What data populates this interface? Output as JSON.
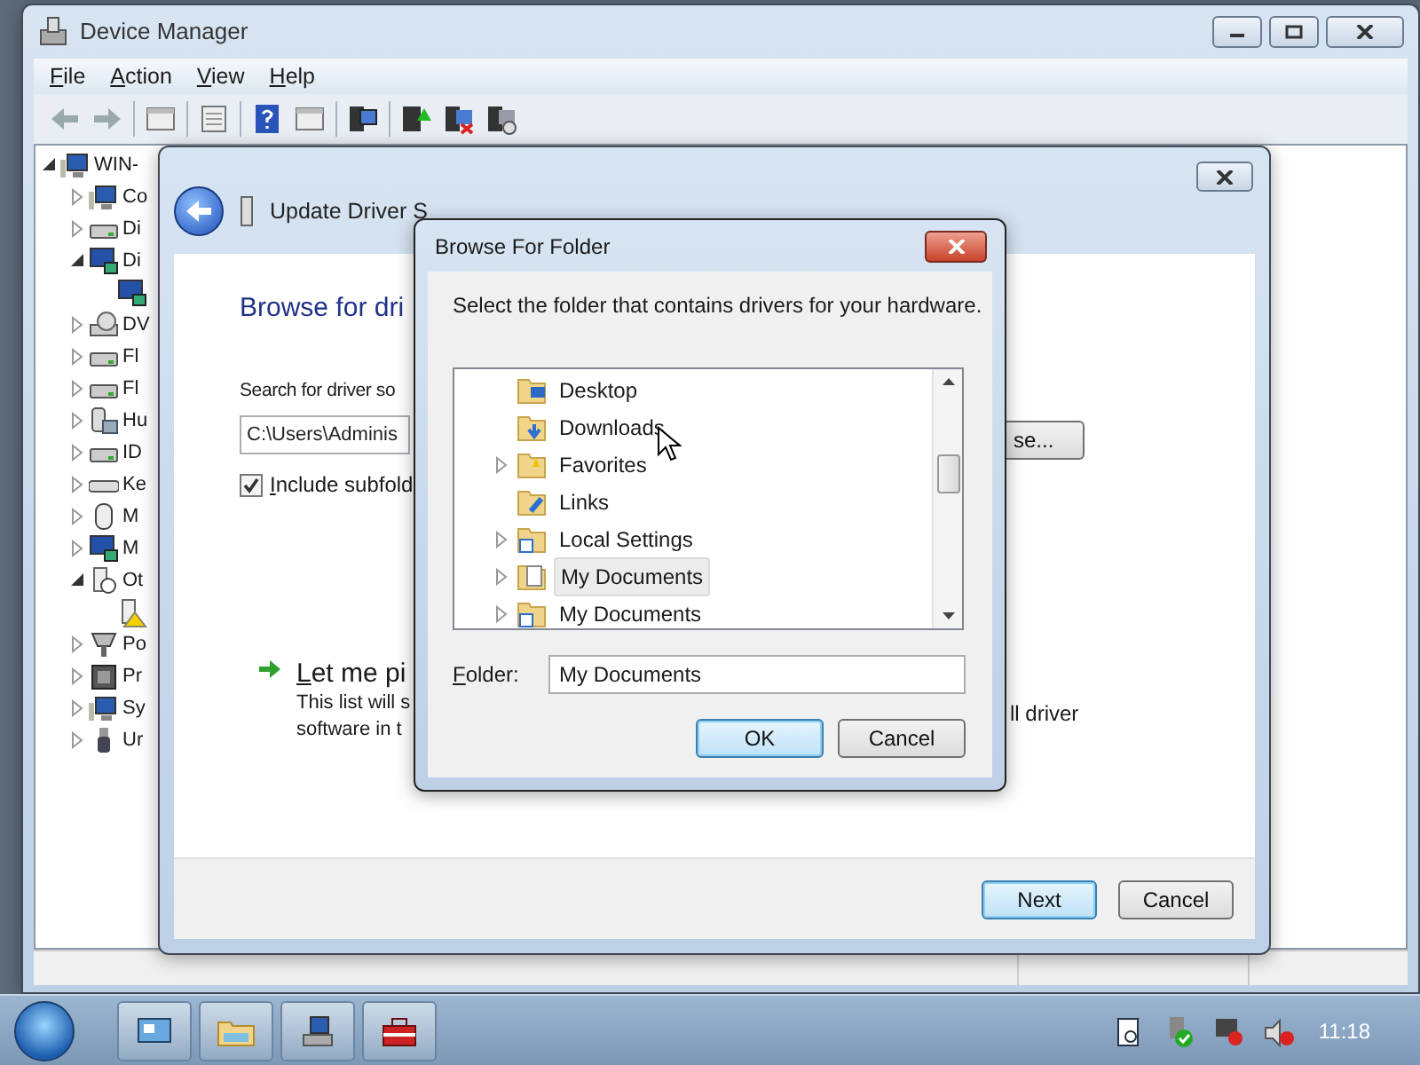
{
  "device_manager": {
    "title": "Device Manager",
    "menu": [
      "File",
      "Action",
      "View",
      "Help"
    ],
    "tree": {
      "label": "WIN-",
      "kind": "computer",
      "expanded": true,
      "children": [
        {
          "label": "Co",
          "kind": "computer",
          "expanded": false
        },
        {
          "label": "Di",
          "kind": "drive",
          "expanded": false
        },
        {
          "label": "Di",
          "kind": "display",
          "expanded": true,
          "children": [
            {
              "kind": "display"
            }
          ]
        },
        {
          "label": "DV",
          "kind": "dvd",
          "expanded": false
        },
        {
          "label": "Fl",
          "kind": "drive",
          "expanded": false
        },
        {
          "label": "Fl",
          "kind": "drive",
          "expanded": false
        },
        {
          "label": "Hu",
          "kind": "hid",
          "expanded": false
        },
        {
          "label": "ID",
          "kind": "drive",
          "expanded": false
        },
        {
          "label": "Ke",
          "kind": "keyboard",
          "expanded": false
        },
        {
          "label": "M",
          "kind": "mouse",
          "expanded": false
        },
        {
          "label": "M",
          "kind": "display",
          "expanded": false
        },
        {
          "label": "Ot",
          "kind": "unknown",
          "expanded": true,
          "children": [
            {
              "kind": "warning"
            }
          ]
        },
        {
          "label": "Po",
          "kind": "port",
          "expanded": false
        },
        {
          "label": "Pr",
          "kind": "chip",
          "expanded": false
        },
        {
          "label": "Sy",
          "kind": "computer",
          "expanded": false
        },
        {
          "label": "Ur",
          "kind": "usb",
          "expanded": false
        }
      ]
    }
  },
  "update_dialog": {
    "title": "Update Driver S",
    "heading": "Browse for dri",
    "search_label": "Search for driver so",
    "path_value": "C:\\Users\\Adminis",
    "browse_button": "se...",
    "include_subfolders": {
      "label": "Include subfold",
      "checked": true
    },
    "pick_option": {
      "title": "Let me pi",
      "line_1": "This list will s",
      "line_1_end": "ll driver",
      "line_2": "software in t"
    },
    "buttons": [
      "Next",
      "Cancel"
    ]
  },
  "browse_dialog": {
    "title": "Browse For Folder",
    "instruction": "Select the folder that contains drivers for your hardware.",
    "folders": [
      {
        "label": "Desktop",
        "kind": "desktop",
        "selected": false
      },
      {
        "label": "Downloads",
        "kind": "downloads",
        "selected": false
      },
      {
        "label": "Favorites",
        "kind": "favorites",
        "expanded": false,
        "selected": false
      },
      {
        "label": "Links",
        "kind": "links",
        "selected": false
      },
      {
        "label": "Local Settings",
        "kind": "shortcut",
        "expanded": false,
        "selected": false
      },
      {
        "label": "My Documents",
        "kind": "documents",
        "expanded": false,
        "selected": true
      },
      {
        "label": "My Documents",
        "kind": "shortcut",
        "expanded": false,
        "selected": false
      }
    ],
    "folder_label": "Folder:",
    "folder_value": "My Documents",
    "buttons": [
      "OK",
      "Cancel"
    ]
  },
  "taskbar": {
    "clock": "11:18"
  }
}
